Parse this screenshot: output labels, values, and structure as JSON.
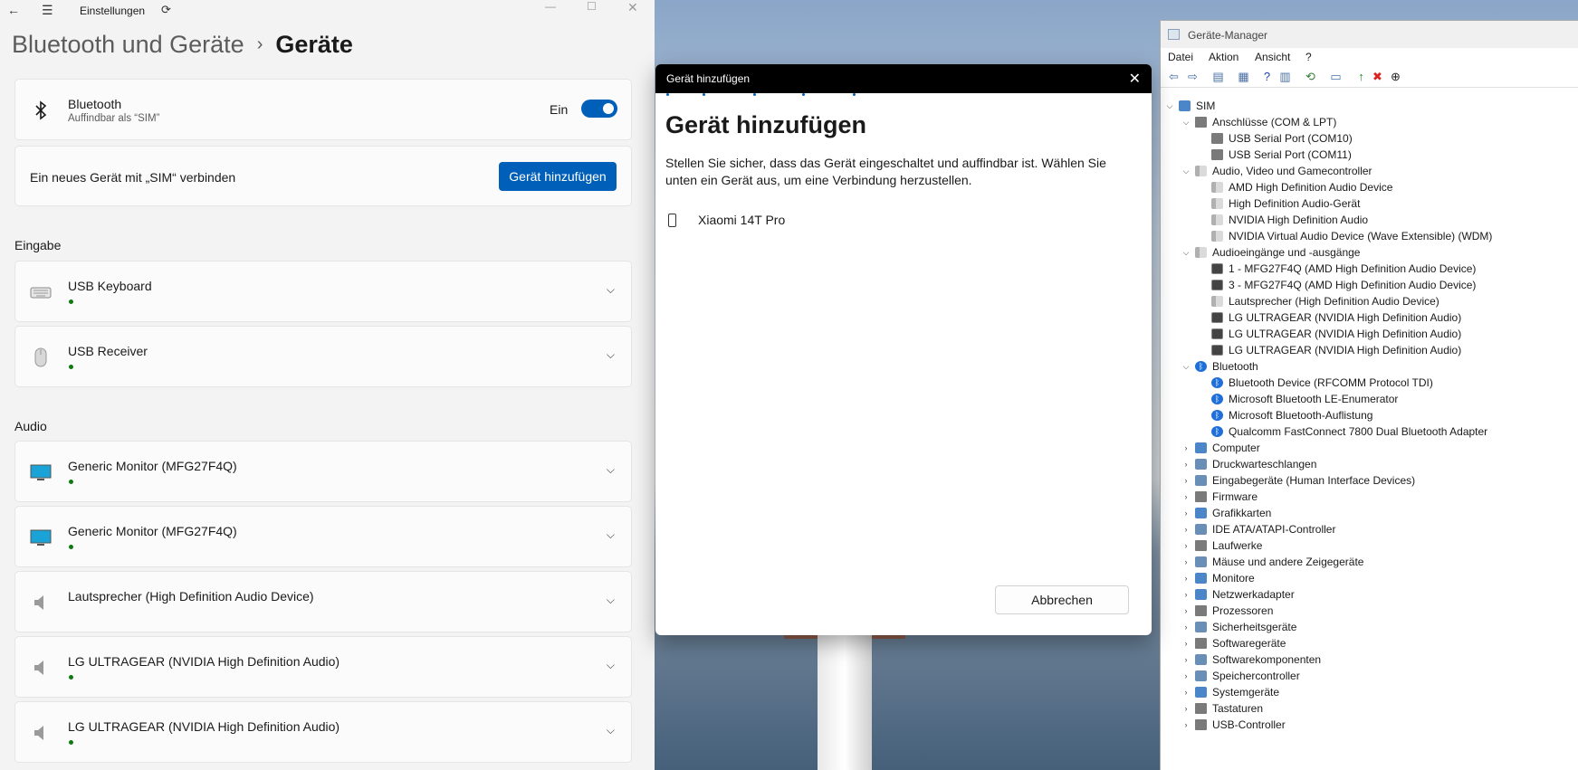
{
  "settings": {
    "window_title": "Einstellungen",
    "breadcrumb": {
      "parent": "Bluetooth und Geräte",
      "separator": "›",
      "current": "Geräte"
    },
    "bluetooth": {
      "name": "Bluetooth",
      "subtitle": "Auffindbar als “SIM”",
      "toggle_label": "Ein",
      "toggle_on": true
    },
    "connect_row": {
      "label": "Ein neues Gerät mit „SIM“ verbinden",
      "button": "Gerät hinzufügen"
    },
    "sections": {
      "input": "Eingabe",
      "audio": "Audio"
    },
    "input_devices": [
      {
        "name": "USB Keyboard",
        "icon": "keyboard-icon"
      },
      {
        "name": "USB Receiver",
        "icon": "mouse-icon"
      }
    ],
    "audio_devices": [
      {
        "name": "Generic Monitor (MFG27F4Q)",
        "icon": "monitor-icon"
      },
      {
        "name": "Generic Monitor (MFG27F4Q)",
        "icon": "monitor-icon"
      },
      {
        "name": "Lautsprecher (High Definition Audio Device)",
        "icon": "speaker-icon"
      },
      {
        "name": "LG ULTRAGEAR (NVIDIA High Definition Audio)",
        "icon": "speaker-icon"
      },
      {
        "name": "LG ULTRAGEAR (NVIDIA High Definition Audio)",
        "icon": "speaker-icon"
      }
    ]
  },
  "dialog": {
    "title_bar": "Gerät hinzufügen",
    "heading": "Gerät hinzufügen",
    "instructions": "Stellen Sie sicher, dass das Gerät eingeschaltet und auffindbar ist. Wählen Sie unten ein Gerät aus, um eine Verbindung herzustellen.",
    "found_device": "Xiaomi 14T Pro",
    "cancel_button": "Abbrechen"
  },
  "device_manager": {
    "title": "Geräte-Manager",
    "menu": [
      "Datei",
      "Aktion",
      "Ansicht",
      "?"
    ],
    "tree": {
      "root": "SIM",
      "ports": {
        "label": "Anschlüsse (COM & LPT)",
        "items": [
          "USB Serial Port (COM10)",
          "USB Serial Port (COM11)"
        ]
      },
      "audio_video": {
        "label": "Audio, Video und Gamecontroller",
        "items": [
          "AMD High Definition Audio Device",
          "High Definition Audio-Gerät",
          "NVIDIA High Definition Audio",
          "NVIDIA Virtual Audio Device (Wave Extensible) (WDM)"
        ]
      },
      "audio_io": {
        "label": "Audioeingänge und -ausgänge",
        "items": [
          "1 - MFG27F4Q (AMD High Definition Audio Device)",
          "3 - MFG27F4Q (AMD High Definition Audio Device)",
          "Lautsprecher (High Definition Audio Device)",
          "LG ULTRAGEAR (NVIDIA High Definition Audio)",
          "LG ULTRAGEAR (NVIDIA High Definition Audio)",
          "LG ULTRAGEAR (NVIDIA High Definition Audio)"
        ]
      },
      "bluetooth": {
        "label": "Bluetooth",
        "items": [
          "Bluetooth Device (RFCOMM Protocol TDI)",
          "Microsoft Bluetooth LE-Enumerator",
          "Microsoft Bluetooth-Auflistung",
          "Qualcomm FastConnect 7800 Dual Bluetooth Adapter"
        ]
      },
      "collapsed": [
        "Computer",
        "Druckwarteschlangen",
        "Eingabegeräte (Human Interface Devices)",
        "Firmware",
        "Grafikkarten",
        "IDE ATA/ATAPI-Controller",
        "Laufwerke",
        "Mäuse und andere Zeigegeräte",
        "Monitore",
        "Netzwerkadapter",
        "Prozessoren",
        "Sicherheitsgeräte",
        "Softwaregeräte",
        "Softwarekomponenten",
        "Speichercontroller",
        "Systemgeräte",
        "Tastaturen",
        "USB-Controller"
      ]
    }
  }
}
